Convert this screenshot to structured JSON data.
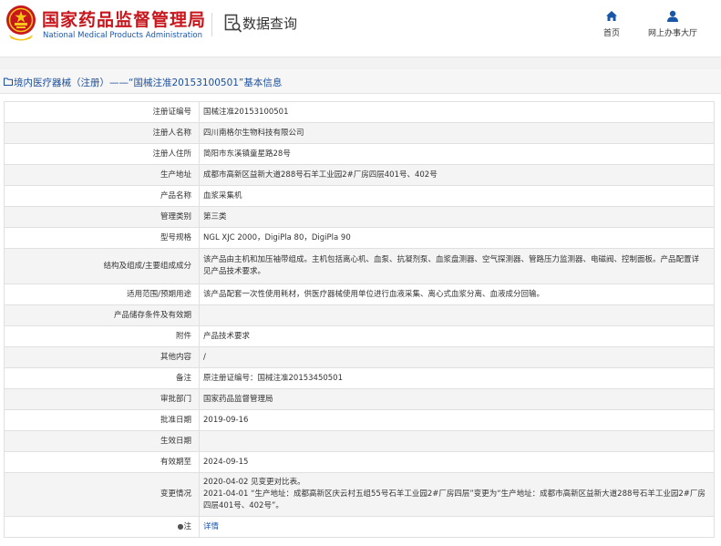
{
  "header": {
    "org_name_cn": "国家药品监督管理局",
    "org_name_en": "National Medical Products Administration",
    "section_title": "数据查询",
    "nav": [
      {
        "label": "首页",
        "icon": "home-icon"
      },
      {
        "label": "网上办事大厅",
        "icon": "user-icon"
      }
    ]
  },
  "breadcrumb": "境内医疗器械（注册）——“国械注准20153100501”基本信息",
  "colors": {
    "brand_red": "#c8161d",
    "brand_blue": "#1a56a8",
    "link_blue": "#1a4f9c"
  },
  "detail_rows": [
    {
      "label": "注册证编号",
      "value": "国械注准20153100501"
    },
    {
      "label": "注册人名称",
      "value": "四川南格尔生物科技有限公司"
    },
    {
      "label": "注册人住所",
      "value": "简阳市东溪镇童星路28号"
    },
    {
      "label": "生产地址",
      "value": "成都市高新区益新大道288号石羊工业园2#厂房四层401号、402号"
    },
    {
      "label": "产品名称",
      "value": "血浆采集机"
    },
    {
      "label": "管理类别",
      "value": "第三类"
    },
    {
      "label": "型号规格",
      "value": "NGL XJC 2000，DigiPla 80，DigiPla 90"
    },
    {
      "label": "结构及组成/主要组成成分",
      "value": "该产品由主机和加压袖带组成。主机包括离心机、血泵、抗凝剂泵、血浆盘测器、空气探测器、管路压力监测器、电磁阀、控制面板。产品配置详见产品技术要求。"
    },
    {
      "label": "适用范围/预期用途",
      "value": "该产品配套一次性使用耗材，供医疗器械使用单位进行血液采集、离心式血浆分离、血液成分回输。"
    },
    {
      "label": "产品储存条件及有效期",
      "value": ""
    },
    {
      "label": "附件",
      "value": "产品技术要求"
    },
    {
      "label": "其他内容",
      "value": "/"
    },
    {
      "label": "备注",
      "value": "原注册证编号：国械注准20153450501"
    },
    {
      "label": "审批部门",
      "value": "国家药品监督管理局"
    },
    {
      "label": "批准日期",
      "value": "2019-09-16"
    },
    {
      "label": "生效日期",
      "value": ""
    },
    {
      "label": "有效期至",
      "value": "2024-09-15"
    },
    {
      "label": "变更情况",
      "value_lines": [
        "2020-04-02 见变更对比表。",
        "2021-04-01 “生产地址：成都高新区庆云村五组55号石羊工业园2#厂房四层”变更为“生产地址：成都市高新区益新大道288号石羊工业园2#厂房四层401号、402号”。"
      ]
    },
    {
      "label": "注",
      "value": "详情",
      "icon": "pin-icon"
    }
  ]
}
